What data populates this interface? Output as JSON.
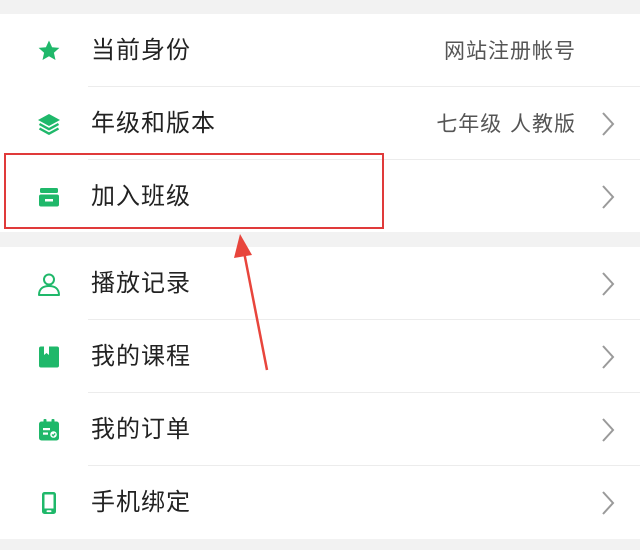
{
  "menu": {
    "group1": [
      {
        "label": "当前身份",
        "value": "网站注册帐号",
        "icon": "star-icon"
      },
      {
        "label": "年级和版本",
        "value": "七年级 人教版",
        "icon": "layers-icon"
      },
      {
        "label": "加入班级",
        "value": "",
        "icon": "class-icon"
      }
    ],
    "group2": [
      {
        "label": "播放记录",
        "icon": "person-icon"
      },
      {
        "label": "我的课程",
        "icon": "book-icon"
      },
      {
        "label": "我的订单",
        "icon": "order-icon"
      },
      {
        "label": "手机绑定",
        "icon": "phone-icon"
      }
    ]
  },
  "colors": {
    "accent": "#1fb86a",
    "highlight": "#e03a3a",
    "background": "#f2f2f2"
  }
}
